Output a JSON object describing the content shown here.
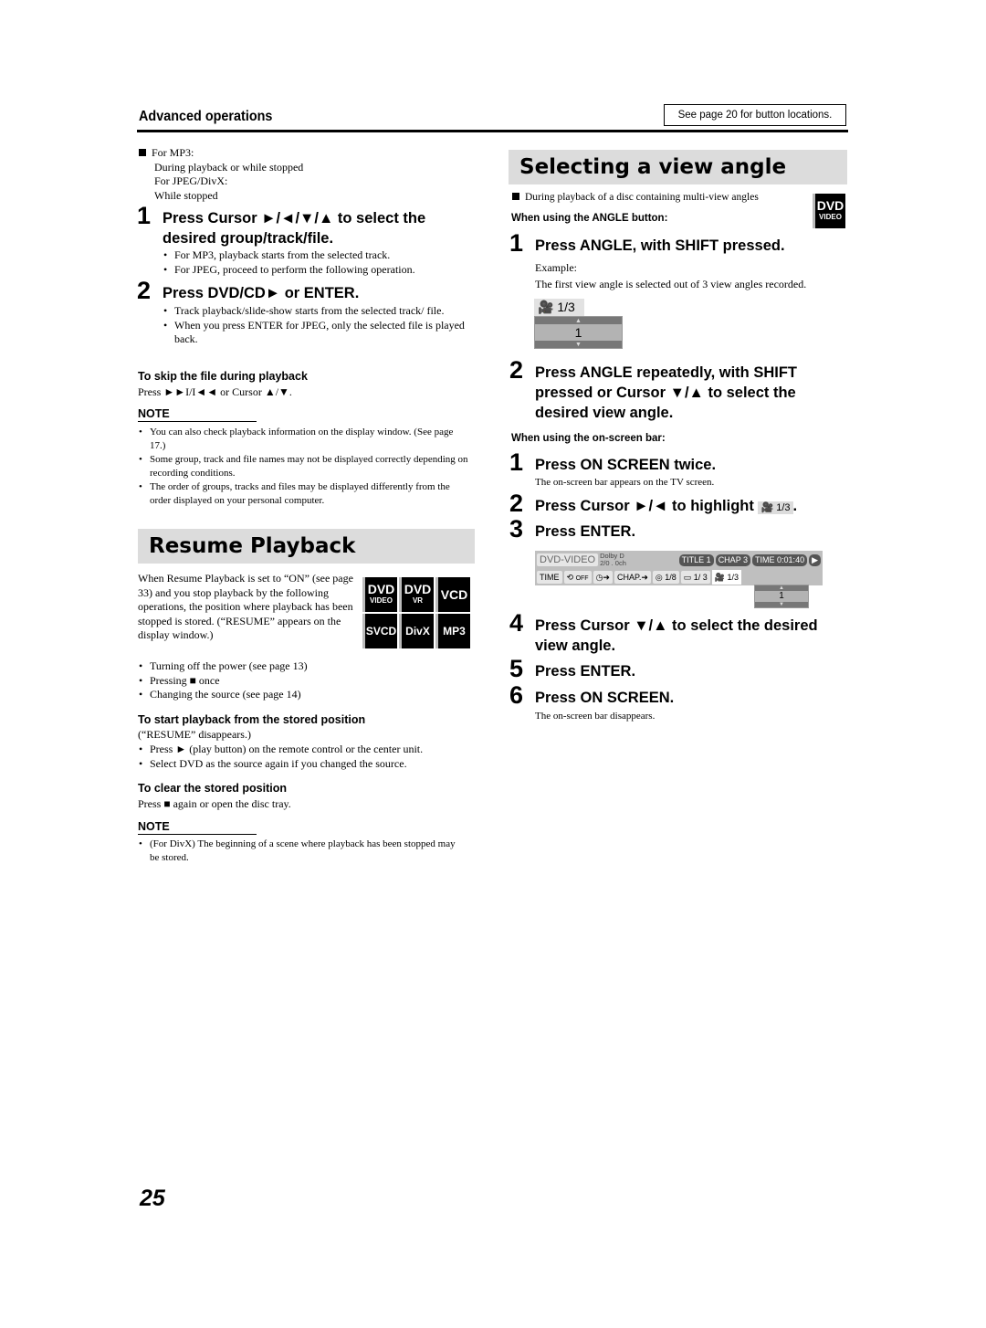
{
  "header": {
    "section_label": "Advanced operations",
    "see_page": "See page 20 for button locations."
  },
  "left": {
    "intro": [
      "For MP3:",
      "During playback or while stopped",
      "For JPEG/DivX:",
      "While stopped"
    ],
    "step1": {
      "num": "1",
      "text": "Press Cursor ►/◄/▼/▲ to select the desired group/track/file.",
      "bullets": [
        "For MP3, playback starts from the selected track.",
        "For JPEG, proceed to perform the following operation."
      ]
    },
    "step2": {
      "num": "2",
      "text": "Press DVD/CD► or ENTER.",
      "bullets": [
        "Track playback/slide-show starts from the selected track/ file.",
        "When you press ENTER for JPEG, only the selected file is played back."
      ]
    },
    "skip": {
      "heading": "To skip the file during playback",
      "text": "Press ►►I/I◄◄ or Cursor ▲/▼."
    },
    "note1": {
      "heading": "NOTE",
      "items": [
        "You can also check playback information on the display window. (See page 17.)",
        "Some group, track and file names may not be displayed correctly depending on recording conditions.",
        "The order of groups, tracks and files may be displayed differently from the order displayed on your personal computer."
      ]
    },
    "resume": {
      "title": "Resume Playback",
      "intro": "When Resume Playback is set to “ON” (see page 33) and you stop playback by the following operations, the position where playback has been stopped is stored. (“RESUME” appears on the display window.)",
      "bullets": [
        "Turning off the power (see page 13)",
        "Pressing ■ once",
        "Changing the source (see page 14)"
      ],
      "badges": [
        {
          "big": "DVD",
          "small": "VIDEO"
        },
        {
          "big": "DVD",
          "small": "VR"
        },
        {
          "big": "VCD",
          "small": ""
        },
        {
          "big": "SVCD",
          "small": ""
        },
        {
          "big": "DivX",
          "small": ""
        },
        {
          "big": "MP3",
          "small": ""
        }
      ],
      "start": {
        "heading": "To start playback from the stored position",
        "sub": "(“RESUME” disappears.)",
        "bullets": [
          "Press ► (play button) on the remote control or the center unit.",
          "Select DVD as the source again if you changed the source."
        ]
      },
      "clear": {
        "heading": "To clear the stored position",
        "text": "Press ■ again or open the disc tray."
      },
      "note": {
        "heading": "NOTE",
        "items": [
          "(For DivX) The beginning of a scene where playback has been stopped may be stored."
        ]
      }
    }
  },
  "right": {
    "title": "Selecting a view angle",
    "condition": "During playback of a disc containing multi-view angles",
    "badge": {
      "big": "DVD",
      "small": "VIDEO"
    },
    "angle_button": {
      "heading": "When using the ANGLE button:",
      "step1": {
        "num": "1",
        "text": "Press ANGLE, with SHIFT pressed."
      },
      "example_label": "Example:",
      "example_text": "The first view angle is selected out of 3 view angles recorded.",
      "display": {
        "label": "1/3",
        "value": "1"
      },
      "step2": {
        "num": "2",
        "text": "Press ANGLE repeatedly, with SHIFT pressed or Cursor ▼/▲ to select the desired view angle."
      }
    },
    "onscreen": {
      "heading": "When using the on-screen bar:",
      "step1": {
        "num": "1",
        "text": "Press ON SCREEN twice.",
        "sub": "The on-screen bar appears on the TV screen."
      },
      "step2": {
        "num": "2",
        "text": "Press Cursor ►/◄ to highlight",
        "chip": "1/3",
        "end": "."
      },
      "step3": {
        "num": "3",
        "text": "Press ENTER."
      },
      "bar": {
        "disc": "DVD-VIDEO",
        "audio1": "Dolby D",
        "audio2": "2/0 . 0ch",
        "title": "TITLE  1",
        "chap": "CHAP  3",
        "time": "TIME   0:01:40",
        "row2": [
          "TIME",
          "OFF",
          "CHAP.➜",
          "1/8",
          "1/  3",
          "1/3"
        ],
        "dropdown_value": "1"
      },
      "step4": {
        "num": "4",
        "text": "Press Cursor ▼/▲ to select the desired view angle."
      },
      "step5": {
        "num": "5",
        "text": "Press ENTER."
      },
      "step6": {
        "num": "6",
        "text": "Press ON SCREEN.",
        "sub": "The on-screen bar disappears."
      }
    }
  },
  "page_number": "25"
}
